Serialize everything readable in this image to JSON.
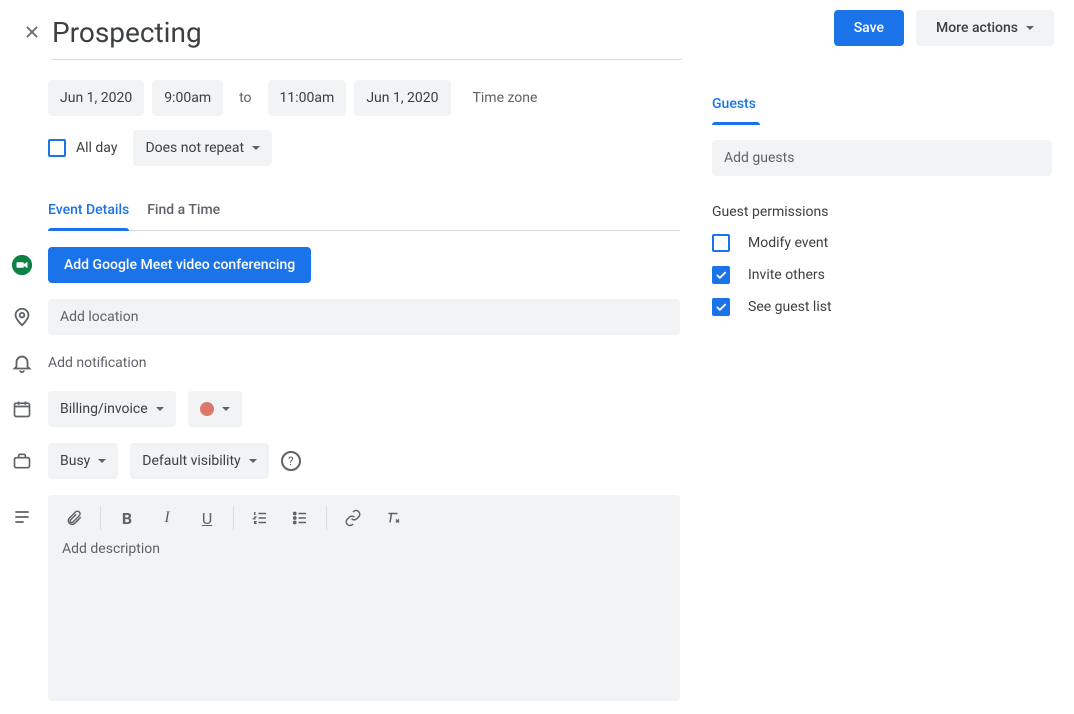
{
  "header": {
    "title": "Prospecting",
    "save_label": "Save",
    "more_actions_label": "More actions"
  },
  "datetime": {
    "start_date": "Jun 1, 2020",
    "start_time": "9:00am",
    "to_label": "to",
    "end_time": "11:00am",
    "end_date": "Jun 1, 2020",
    "timezone_label": "Time zone",
    "all_day_label": "All day",
    "all_day_checked": false,
    "repeat_label": "Does not repeat"
  },
  "tabs": {
    "event_details": "Event Details",
    "find_time": "Find a Time"
  },
  "meet": {
    "button_label": "Add Google Meet video conferencing"
  },
  "location": {
    "placeholder": "Add location"
  },
  "notification": {
    "label": "Add notification"
  },
  "calendar": {
    "name": "Billing/invoice",
    "color": "#e67c73"
  },
  "visibility": {
    "busy_label": "Busy",
    "visibility_label": "Default visibility"
  },
  "description": {
    "placeholder": "Add description"
  },
  "guests": {
    "header": "Guests",
    "add_placeholder": "Add guests",
    "permissions_title": "Guest permissions",
    "modify_label": "Modify event",
    "invite_label": "Invite others",
    "see_list_label": "See guest list",
    "modify_checked": false,
    "invite_checked": true,
    "see_list_checked": true
  }
}
